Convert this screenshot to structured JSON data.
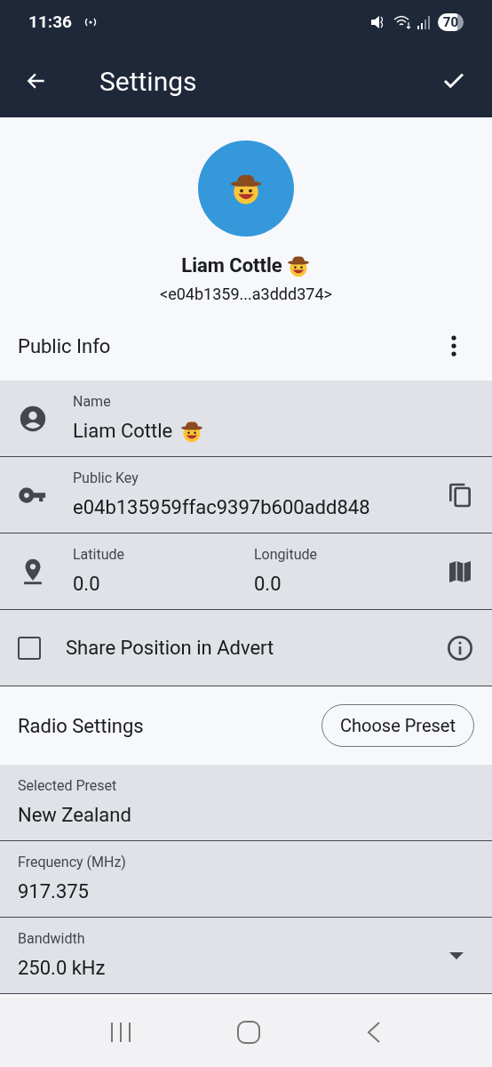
{
  "status_bar": {
    "time": "11:36",
    "battery": "70"
  },
  "app_bar": {
    "title": "Settings"
  },
  "profile": {
    "name": "Liam Cottle",
    "key": "<e04b1359...a3ddd374>"
  },
  "public_info": {
    "title": "Public Info",
    "name_field": {
      "label": "Name",
      "value": "Liam Cottle"
    },
    "key_field": {
      "label": "Public Key",
      "value": "e04b135959ffac9397b600add848"
    },
    "latitude": {
      "label": "Latitude",
      "value": "0.0"
    },
    "longitude": {
      "label": "Longitude",
      "value": "0.0"
    },
    "share_position": {
      "label": "Share Position in Advert",
      "checked": false
    }
  },
  "radio_settings": {
    "title": "Radio Settings",
    "button": "Choose Preset",
    "fields": [
      {
        "kind": "text",
        "label": "Selected Preset",
        "value": "New Zealand"
      },
      {
        "kind": "text",
        "label": "Frequency (MHz)",
        "value": "917.375"
      },
      {
        "kind": "dropdown",
        "label": "Bandwidth",
        "value": "250.0 kHz"
      }
    ]
  }
}
